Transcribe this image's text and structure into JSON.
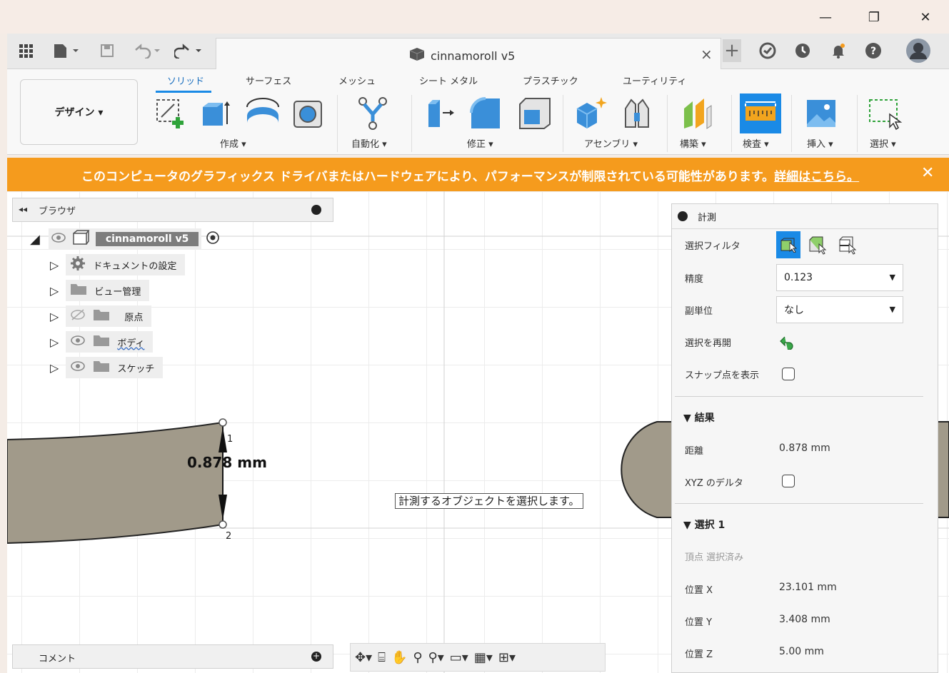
{
  "window_controls": {
    "minimize": "—",
    "restore": "❐",
    "close": "✕"
  },
  "app_bar": {
    "doc_title": "cinnamoroll v5",
    "close": "×",
    "plus": "+"
  },
  "ribbon": {
    "design_label": "デザイン ▾",
    "tabs": [
      "ソリッド",
      "サーフェス",
      "メッシュ",
      "シート メタル",
      "プラスチック",
      "ユーティリティ"
    ],
    "groups": [
      "作成 ▾",
      "自動化 ▾",
      "修正 ▾",
      "アセンブリ ▾",
      "構築 ▾",
      "検査 ▾",
      "挿入 ▾",
      "選択 ▾"
    ]
  },
  "banner": {
    "message": "このコンピュータのグラフィックス ドライバまたはハードウェアにより、パフォーマンスが制限されている可能性があります。",
    "link": "詳細はこちら。",
    "close": "✕"
  },
  "browser": {
    "title": "ブラウザ",
    "collapse": "◂◂",
    "root": "cinnamoroll v5",
    "items": [
      "ドキュメントの設定",
      "ビュー管理",
      "原点",
      "ボディ",
      "スケッチ"
    ]
  },
  "viewport": {
    "dimension": "0.878 mm",
    "point1": "1",
    "point2": "2",
    "tooltip": "計測するオブジェクトを選択します。"
  },
  "measure": {
    "title": "計測",
    "filter_label": "選択フィルタ",
    "precision_label": "精度",
    "precision_value": "0.123",
    "subunit_label": "副単位",
    "subunit_value": "なし",
    "restart_label": "選択を再開",
    "snap_label": "スナップ点を表示",
    "results_title": "▼ 結果",
    "distance_label": "距離",
    "distance_value": "0.878 mm",
    "xyz_label": "XYZ のデルタ",
    "selection_title": "▼ 選択 1",
    "vertex_selected": "頂点 選択済み",
    "pos_x_label": "位置 X",
    "pos_x_value": "23.101 mm",
    "pos_y_label": "位置 Y",
    "pos_y_value": "3.408 mm",
    "pos_z_label": "位置 Z",
    "pos_z_value": "5.00 mm"
  },
  "comments": {
    "title": "コメント"
  },
  "colors": {
    "accent": "#1a8ae6",
    "banner": "#f59b1d",
    "body_fill": "#a19a8a"
  }
}
